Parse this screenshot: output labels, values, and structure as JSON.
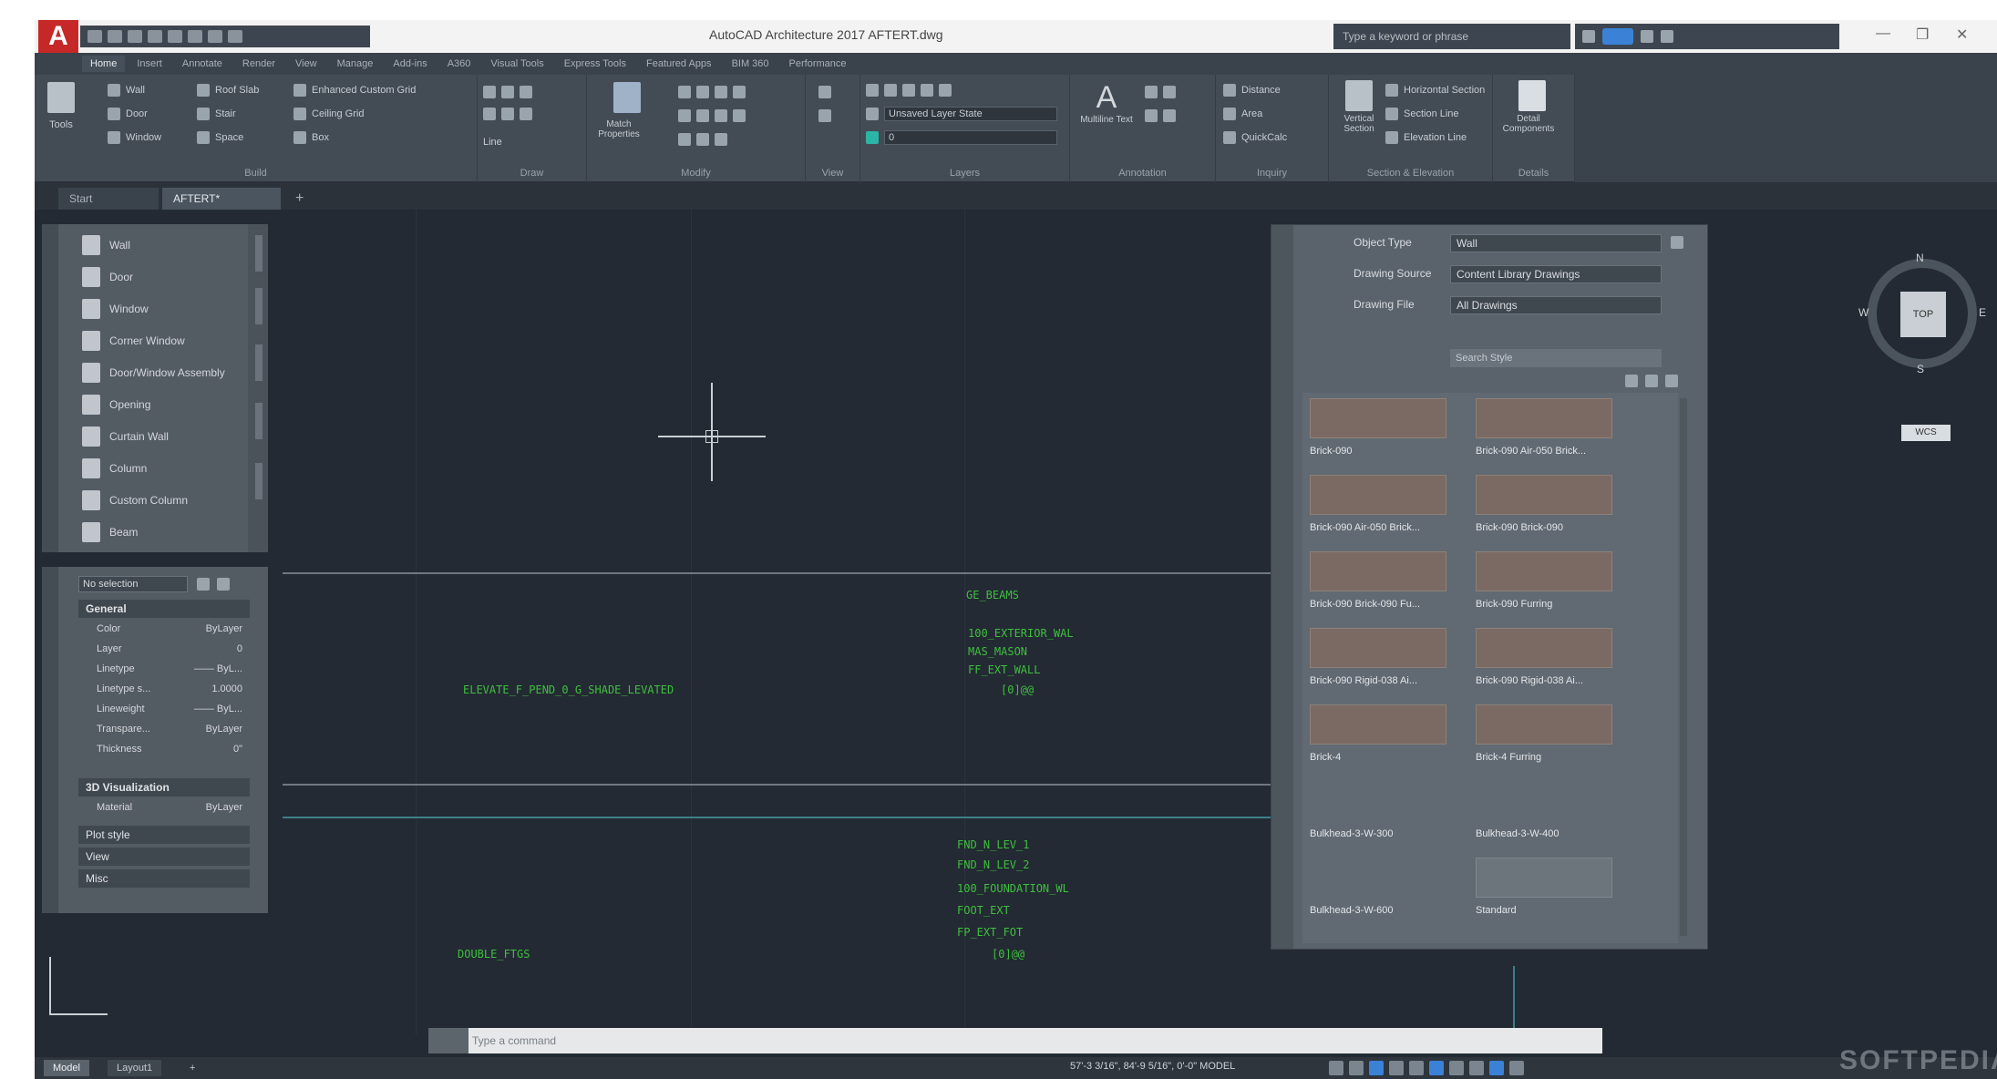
{
  "window": {
    "title": "AutoCAD Architecture 2017    AFTERT.dwg",
    "search_placeholder": "Type a keyword or phrase",
    "app_letter": "A"
  },
  "menu": {
    "tabs": [
      "Home",
      "Insert",
      "Annotate",
      "Render",
      "View",
      "Manage",
      "Add-ins",
      "A360",
      "Visual Tools",
      "Express Tools",
      "Featured Apps",
      "BIM 360",
      "Performance"
    ]
  },
  "ribbon": {
    "build": {
      "title": "Build",
      "tools_label": "Tools",
      "rows": [
        [
          "Wall",
          "Roof Slab",
          "Enhanced Custom Grid"
        ],
        [
          "Door",
          "Stair",
          "Ceiling Grid"
        ],
        [
          "Window",
          "Space",
          "Box"
        ]
      ]
    },
    "draw": {
      "title": "Draw",
      "line_label": "Line"
    },
    "modify": {
      "title": "Modify",
      "match_properties": "Match Properties"
    },
    "view": {
      "title": "View"
    },
    "layers": {
      "title": "Layers",
      "layer_state": "Unsaved Layer State",
      "layer_combo": "0"
    },
    "annotation": {
      "title": "Annotation",
      "multiline": "Multiline Text"
    },
    "inquiry": {
      "title": "Inquiry",
      "distance": "Distance",
      "area": "Area",
      "quick_calc": "QuickCalc"
    },
    "section": {
      "title": "Section & Elevation",
      "vertical_section": "Vertical Section",
      "items": [
        "Horizontal Section",
        "Section Line",
        "Elevation Line"
      ]
    },
    "details": {
      "title": "Details",
      "detail_components": "Detail Components"
    }
  },
  "doc_tabs": [
    "Start",
    "AFTERT*"
  ],
  "palette": {
    "items": [
      "Wall",
      "Door",
      "Window",
      "Corner Window",
      "Door/Window Assembly",
      "Opening",
      "Curtain Wall",
      "Column",
      "Custom Column",
      "Beam"
    ]
  },
  "properties": {
    "selector": "No selection",
    "general": "General",
    "rows": [
      {
        "label": "Color",
        "value": "ByLayer"
      },
      {
        "label": "Layer",
        "value": "0"
      },
      {
        "label": "Linetype",
        "value": "—— ByL..."
      },
      {
        "label": "Linetype s...",
        "value": "1.0000"
      },
      {
        "label": "Lineweight",
        "value": "—— ByL..."
      },
      {
        "label": "Transpare...",
        "value": "ByLayer"
      },
      {
        "label": "Thickness",
        "value": "0\""
      }
    ],
    "visualization": "3D Visualization",
    "material_label": "Material",
    "material_value": "ByLayer",
    "collapsed": [
      "Plot style",
      "View",
      "Misc"
    ]
  },
  "style_browser": {
    "object_type_label": "Object Type",
    "object_type": "Wall",
    "drawing_source_label": "Drawing Source",
    "drawing_source": "Content Library Drawings",
    "drawing_file_label": "Drawing File",
    "drawing_file": "All Drawings",
    "search": "Search Style",
    "styles": [
      {
        "name": "Brick-090",
        "tile": "brick"
      },
      {
        "name": "Brick-090 Air-050 Brick...",
        "tile": "brick"
      },
      {
        "name": "Brick-090 Air-050 Brick...",
        "tile": "brick"
      },
      {
        "name": "Brick-090 Brick-090",
        "tile": "brick"
      },
      {
        "name": "Brick-090 Brick-090 Fu...",
        "tile": "brick"
      },
      {
        "name": "Brick-090 Furring",
        "tile": "brick"
      },
      {
        "name": "Brick-090 Rigid-038 Ai...",
        "tile": "brick"
      },
      {
        "name": "Brick-090 Rigid-038 Ai...",
        "tile": "brick"
      },
      {
        "name": "Brick-4",
        "tile": "brick"
      },
      {
        "name": "Brick-4 Furring",
        "tile": "brick"
      },
      {
        "name": "Bulkhead-3-W-300",
        "tile": "none"
      },
      {
        "name": "Bulkhead-3-W-400",
        "tile": "none"
      },
      {
        "name": "Bulkhead-3-W-600",
        "tile": "none"
      },
      {
        "name": "Standard",
        "tile": "empty"
      }
    ]
  },
  "viewcube": {
    "face": "TOP",
    "north": "N",
    "east": "E",
    "south": "S",
    "west": "W",
    "wcs": "WCS"
  },
  "drawing_text": {
    "a1": "GE_BEAMS",
    "a2": "100_EXTERIOR_WAL",
    "a3": "MAS_MASON",
    "a4": "FF_EXT_WALL",
    "a5": "ELEVATE_F_PEND_0_G_SHADE_LEVATED",
    "a6": "[0]@@",
    "b1": "FND_N_LEV_1",
    "b2": "FND_N_LEV_2",
    "b3": "100_FOUNDATION_WL",
    "b4": "FOOT_EXT",
    "b5": "FP_EXT_FOT",
    "b6": "DOUBLE_FTGS",
    "b7": "[0]@@"
  },
  "command_line": {
    "placeholder": "Type a command"
  },
  "status": {
    "tabs": [
      "Model",
      "Layout1"
    ],
    "coords": "57'-3 3/16\", 84'-9 5/16\", 0'-0\"  MODEL"
  },
  "watermark": "SOFTPEDIA"
}
